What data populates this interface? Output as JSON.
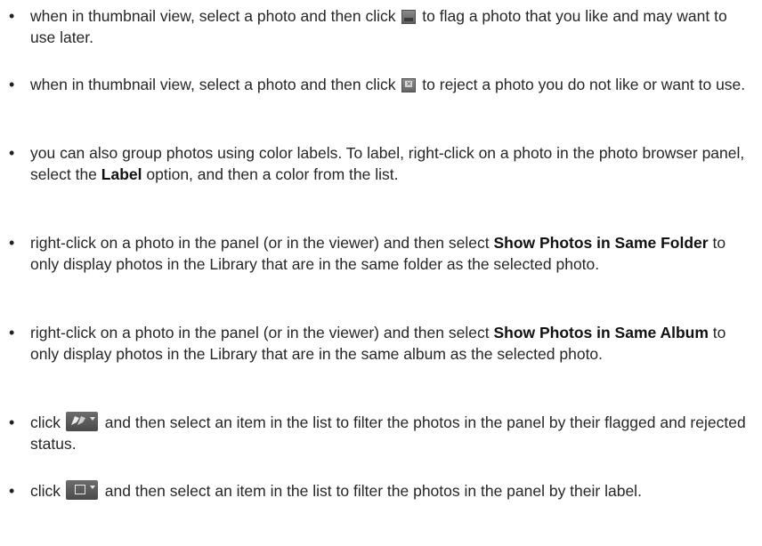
{
  "bullet_glyph": "•",
  "items": [
    {
      "t1": "when in thumbnail view, select a photo and then click",
      "t2": "to flag a photo that you like and may want to use later."
    },
    {
      "t1": "when in thumbnail view, select a photo and then click",
      "t2": "to reject a photo you do not like or want to use."
    },
    {
      "t1": "you can also group photos using color labels. To label, right-click on a photo in the photo browser panel, select the",
      "b1": "Label",
      "t2": "option, and then a color from the list."
    },
    {
      "t1": "right-click on a photo in the panel (or in the viewer) and then select",
      "b1": "Show Photos in Same Folder",
      "t2": "to only display photos in the Library that are in the same folder as the selected photo."
    },
    {
      "t1": "right-click on a photo in the panel (or in the viewer) and then select",
      "b1": "Show Photos in Same Album",
      "t2": "to only display photos in the Library that are in the same album as the selected photo."
    },
    {
      "t1": "click",
      "t2": "and then select an item in the list to filter the photos in the panel by their flagged and rejected status."
    },
    {
      "t1": "click",
      "t2": "and then select an item in the list to filter the photos in the panel by their label."
    }
  ],
  "icons": {
    "flag": "flag-icon",
    "reject": "reject-icon",
    "flag_filter": "flag-filter-dropdown-icon",
    "label_filter": "label-filter-dropdown-icon"
  }
}
